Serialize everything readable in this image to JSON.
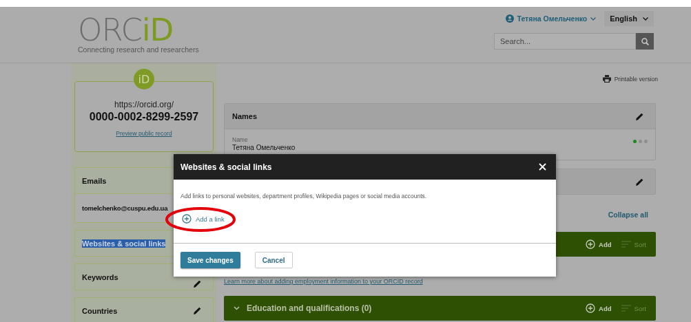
{
  "header": {
    "logo": {
      "main": "ORC",
      "accent": "iD",
      "tagline": "Connecting research and researchers"
    },
    "user": "Тетяна Омельченко",
    "language": "English",
    "search": {
      "placeholder": "Search..."
    }
  },
  "sidebar": {
    "id_card": {
      "badge": "iD",
      "url": "https://orcid.org/",
      "orcid": "0000-0002-8299-2597",
      "link": "Preview public record"
    },
    "sections": [
      {
        "title": "Emails",
        "text_selected": false,
        "items": [
          "tomelchenko@cuspu.edu.ua"
        ]
      },
      {
        "title": "Websites & social links",
        "text_selected": true
      },
      {
        "title": "Keywords",
        "editable": true,
        "text_selected": false
      },
      {
        "title": "Countries",
        "editable": true,
        "text_selected": false
      }
    ]
  },
  "main": {
    "printable": "Printable version",
    "panels": [
      {
        "title": "Names",
        "editable": true,
        "fields": [
          {
            "label": "Name",
            "value": "Тетяна Омельченко"
          }
        ],
        "visibility": [
          {
            "selected": true
          },
          {
            "selected": false
          },
          {
            "selected": false
          }
        ]
      },
      {
        "editable": true
      }
    ],
    "collapse": "Collapse all",
    "sections": [
      {
        "add": "Add",
        "sort": "Sort",
        "link": "Learn more about adding employment information to your ORCID record"
      },
      {
        "title": "Education and qualifications (0)",
        "add": "Add",
        "sort": "Sort"
      }
    ]
  },
  "dialog": {
    "title": "Websites & social links",
    "description": "Add links to personal websites, department profiles, Wikipedia pages or social media accounts.",
    "add_link": "Add a link",
    "highlighted": true,
    "buttons": [
      {
        "label": "Save changes",
        "kind": "primary"
      },
      {
        "label": "Cancel",
        "kind": "secondary"
      }
    ]
  }
}
